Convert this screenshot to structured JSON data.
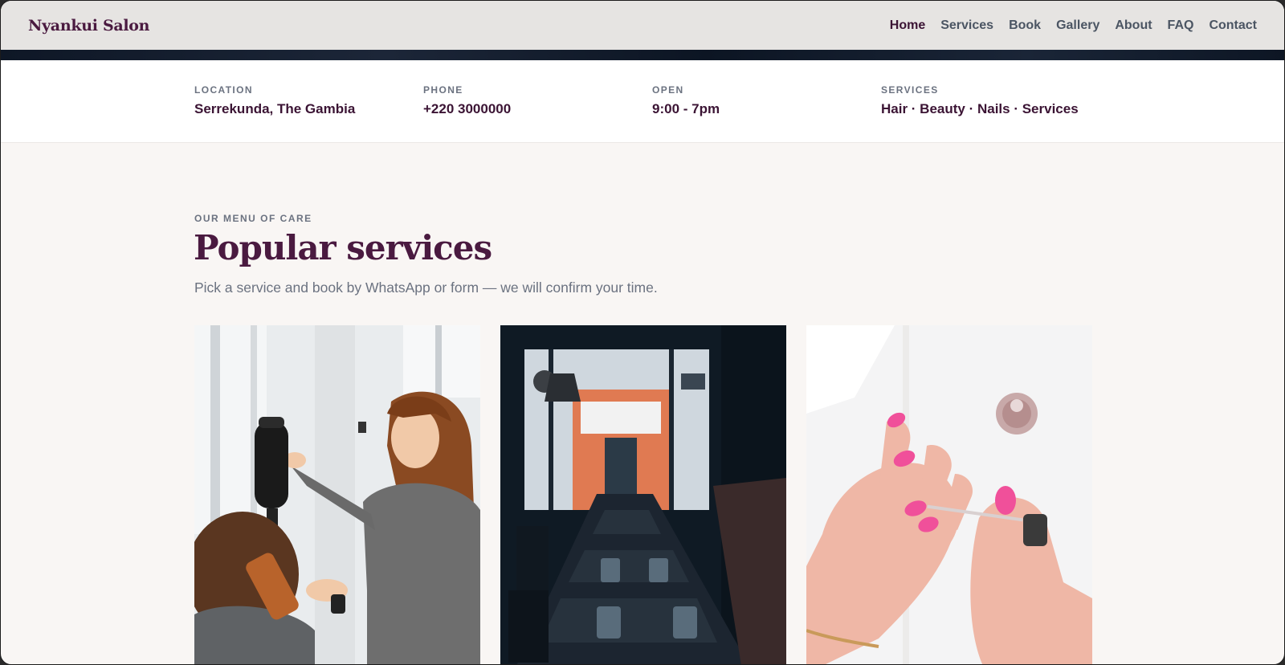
{
  "brand": "Nyankui Salon",
  "nav": [
    {
      "label": "Home",
      "active": true
    },
    {
      "label": "Services"
    },
    {
      "label": "Book"
    },
    {
      "label": "Gallery"
    },
    {
      "label": "About"
    },
    {
      "label": "FAQ"
    },
    {
      "label": "Contact"
    }
  ],
  "info": [
    {
      "label": "LOCATION",
      "value": "Serrekunda, The Gambia"
    },
    {
      "label": "PHONE",
      "value": "+220 3000000"
    },
    {
      "label": "OPEN",
      "value": "9:00 - 7pm"
    },
    {
      "label": "SERVICES",
      "value": "Hair · Beauty · Nails · Services"
    }
  ],
  "section": {
    "eyebrow": "OUR MENU OF CARE",
    "title": "Popular services",
    "subtitle": "Pick a service and book by WhatsApp or form — we will confirm your time."
  },
  "cards": [
    {
      "image": "hair-styling-photo"
    },
    {
      "image": "salon-interior-photo"
    },
    {
      "image": "nail-polish-photo"
    }
  ],
  "colors": {
    "brand": "#4a1a40",
    "header_bg": "#e6e4e2",
    "page_bg": "#f9f6f4",
    "muted": "#6b7280"
  }
}
